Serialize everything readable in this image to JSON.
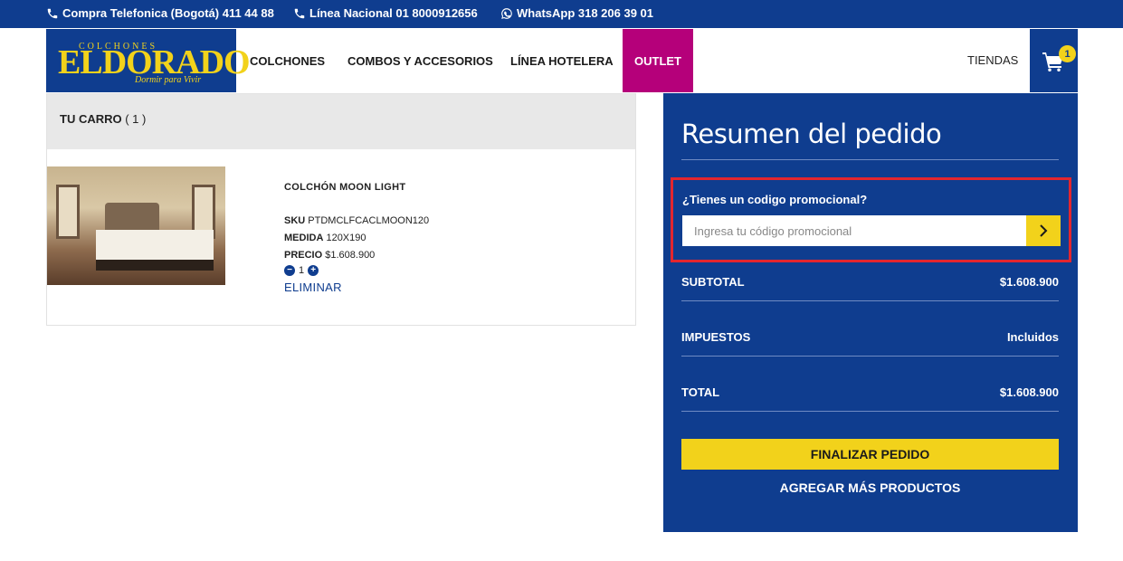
{
  "topbar": {
    "phone1": "Compra Telefonica (Bogotá) 411 44 88",
    "phone2": "Línea Nacional 01 8000912656",
    "whatsapp": "WhatsApp 318 206 39 01"
  },
  "header": {
    "logo_top": "COLCHONES",
    "logo_brand": "ELDORADO",
    "logo_tagline": "Dormir para Vivir",
    "nav": [
      "COLCHONES",
      "COMBOS Y ACCESORIOS",
      "LÍNEA HOTELERA",
      "OUTLET"
    ],
    "stores": "TIENDAS",
    "cart_count": "1"
  },
  "cart": {
    "title": "TU CARRO",
    "count": "( 1 )",
    "product": {
      "name": "COLCHÓN MOON LIGHT",
      "sku_label": "SKU",
      "sku": "PTDMCLFCACLMOON120",
      "size_label": "MEDIDA",
      "size": "120X190",
      "price_label": "PRECIO",
      "price": "$1.608.900",
      "quantity": "1",
      "minus": "−",
      "plus": "+",
      "remove": "ELIMINAR"
    }
  },
  "summary": {
    "title": "Resumen del pedido",
    "promo_question": "¿Tienes un codigo promocional?",
    "promo_placeholder": "Ingresa tu código promocional",
    "subtotal_label": "SUBTOTAL",
    "subtotal_value": "$1.608.900",
    "tax_label": "IMPUESTOS",
    "tax_value": "Incluidos",
    "total_label": "TOTAL",
    "total_value": "$1.608.900",
    "checkout": "FINALIZAR PEDIDO",
    "add_more": "AGREGAR MÁS PRODUCTOS"
  },
  "colors": {
    "brand_blue": "#0f3d8f",
    "brand_yellow": "#f2d21b",
    "outlet_magenta": "#b5007a",
    "highlight_red": "#e3262e"
  }
}
